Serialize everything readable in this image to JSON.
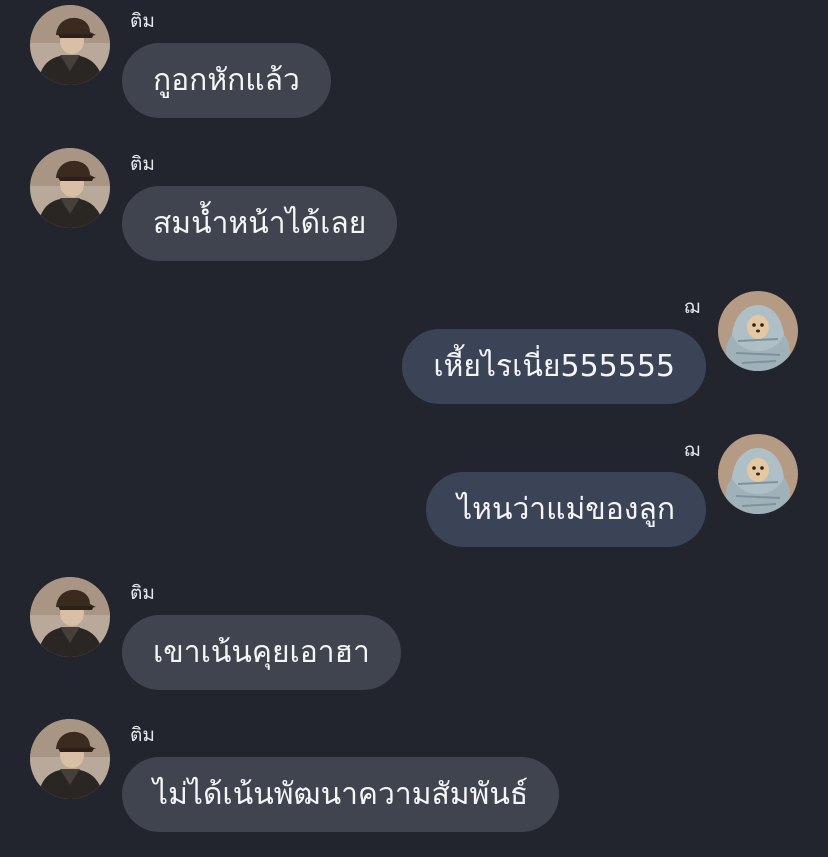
{
  "messages": [
    {
      "sender": "ติม",
      "text": "กูอกหักแล้ว",
      "direction": "incoming",
      "avatar": "user-avatar-cap"
    },
    {
      "sender": "ติม",
      "text": "สมน้ำหน้าได้เลย",
      "direction": "incoming",
      "avatar": "user-avatar-cap"
    },
    {
      "sender": "ฌ",
      "text": "เหี้ยไรเนี่ย555555",
      "direction": "outgoing",
      "avatar": "user-avatar-wrapped"
    },
    {
      "sender": "ฌ",
      "text": "ไหนว่าแม่ของลูก",
      "direction": "outgoing",
      "avatar": "user-avatar-wrapped"
    },
    {
      "sender": "ติม",
      "text": "เขาเน้นคุยเอาฮา",
      "direction": "incoming",
      "avatar": "user-avatar-cap"
    },
    {
      "sender": "ติม",
      "text": "ไม่ได้เน้นพัฒนาความสัมพันธ์",
      "direction": "incoming",
      "avatar": "user-avatar-cap"
    }
  ],
  "colors": {
    "background": "#22252d",
    "incoming_bubble": "#40444e",
    "outgoing_bubble": "#3b4456",
    "text": "#f4f5f7"
  }
}
